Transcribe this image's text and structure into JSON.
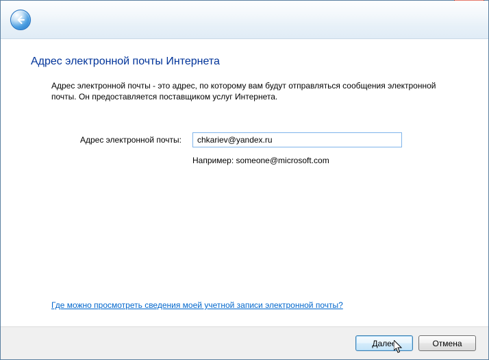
{
  "title": "Адрес электронной почты Интернета",
  "description": "Адрес электронной почты - это адрес, по которому вам будут отправляться сообщения электронной почты. Он предоставляется поставщиком услуг Интернета.",
  "email_label": "Адрес электронной почты:",
  "email_value": "chkariev@yandex.ru",
  "example": "Например: someone@microsoft.com",
  "help_link": "Где можно просмотреть сведения моей учетной записи электронной почты?",
  "buttons": {
    "next": "Далее",
    "cancel": "Отмена"
  }
}
